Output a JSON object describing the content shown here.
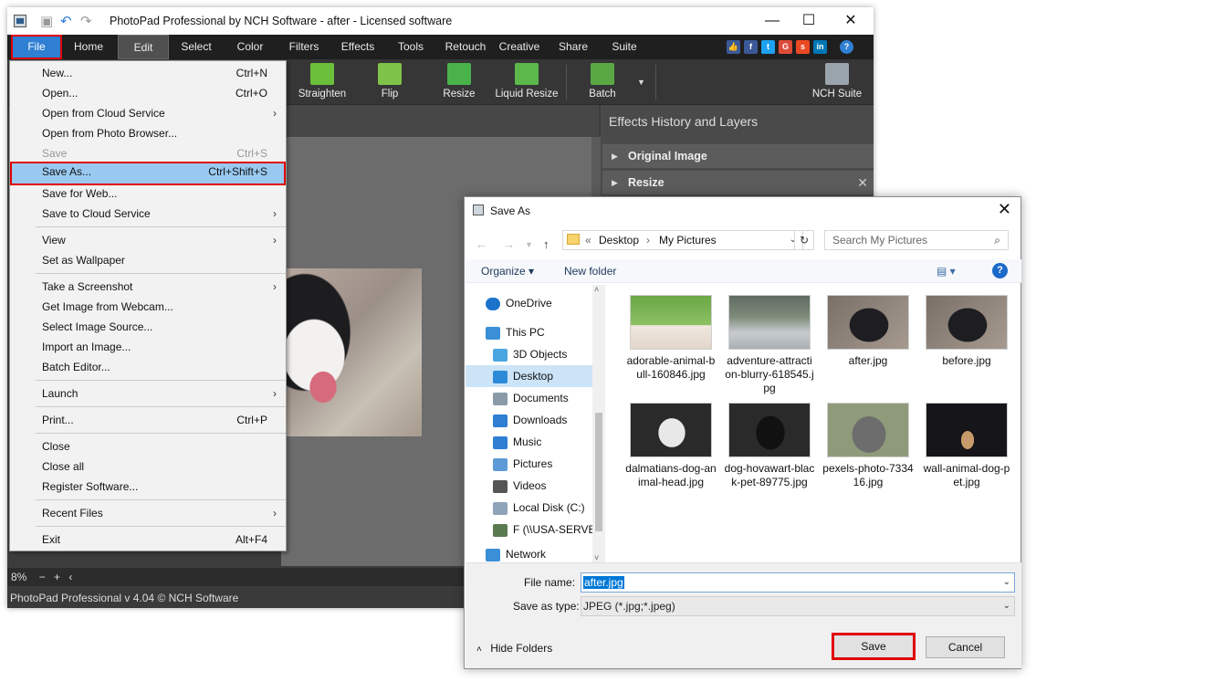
{
  "app": {
    "title": "PhotoPad Professional by NCH Software - after - Licensed software",
    "minimize": "—",
    "maximize": "☐",
    "close": "✕",
    "menu": [
      "File",
      "Home",
      "Edit",
      "Select",
      "Color",
      "Filters",
      "Effects",
      "Tools",
      "Retouch",
      "Creative",
      "Share",
      "Suite"
    ],
    "toolbar": [
      {
        "label": "Straighten",
        "icon": "straighten-icon",
        "color": "#6bbf3a"
      },
      {
        "label": "Flip",
        "icon": "flip-icon",
        "color": "#7fc24a"
      },
      {
        "label": "Resize",
        "icon": "resize-icon",
        "color": "#49b34a"
      },
      {
        "label": "Liquid Resize",
        "icon": "liquid-resize-icon",
        "color": "#5cb84a"
      },
      {
        "label": "Batch",
        "icon": "batch-icon",
        "color": "#5aa844"
      },
      {
        "label": "NCH Suite",
        "icon": "nch-suite-icon",
        "color": "#9aa4ad"
      }
    ],
    "panel_title": "Effects History and Layers",
    "history": [
      "Original Image",
      "Resize"
    ],
    "zoom": "8%",
    "status": "PhotoPad Professional v 4.04 © NCH Software"
  },
  "file_menu": {
    "items": [
      {
        "label": "New...",
        "shortcut": "Ctrl+N"
      },
      {
        "label": "Open...",
        "shortcut": "Ctrl+O"
      },
      {
        "label": "Open from Cloud Service",
        "submenu": true
      },
      {
        "label": "Open from Photo Browser..."
      },
      {
        "label": "Save",
        "shortcut": "Ctrl+S",
        "disabled": true
      },
      {
        "label": "Save As...",
        "shortcut": "Ctrl+Shift+S",
        "highlighted": true
      },
      {
        "label": "Save for Web..."
      },
      {
        "label": "Save to Cloud Service",
        "submenu": true
      },
      {
        "label": "View",
        "submenu": true
      },
      {
        "label": "Set as Wallpaper"
      },
      {
        "label": "Take a Screenshot",
        "submenu": true
      },
      {
        "label": "Get Image from Webcam..."
      },
      {
        "label": "Select Image Source..."
      },
      {
        "label": "Import an Image..."
      },
      {
        "label": "Batch Editor..."
      },
      {
        "label": "Launch",
        "submenu": true
      },
      {
        "label": "Print...",
        "shortcut": "Ctrl+P"
      },
      {
        "label": "Close"
      },
      {
        "label": "Close all"
      },
      {
        "label": "Register Software..."
      },
      {
        "label": "Recent Files",
        "submenu": true
      },
      {
        "label": "Exit",
        "shortcut": "Alt+F4"
      }
    ]
  },
  "dialog": {
    "title": "Save As",
    "close": "✕",
    "breadcrumb": [
      "«",
      "Desktop",
      "›",
      "My Pictures"
    ],
    "search_placeholder": "Search My Pictures",
    "organize": "Organize ▾",
    "new_folder": "New folder",
    "help": "?",
    "nav": [
      {
        "label": "OneDrive",
        "icon": "onedrive-icon",
        "color": "#1c73cc"
      },
      {
        "label": "This PC",
        "icon": "pc-icon",
        "color": "#3a8fd6"
      },
      {
        "label": "3D Objects",
        "icon": "3d-objects-icon",
        "color": "#4aa6e0"
      },
      {
        "label": "Desktop",
        "icon": "desktop-icon",
        "color": "#2d8ad8",
        "selected": true
      },
      {
        "label": "Documents",
        "icon": "documents-icon",
        "color": "#8a9aa8"
      },
      {
        "label": "Downloads",
        "icon": "downloads-icon",
        "color": "#2f7fd3"
      },
      {
        "label": "Music",
        "icon": "music-icon",
        "color": "#2f7fd3"
      },
      {
        "label": "Pictures",
        "icon": "pictures-icon",
        "color": "#5c9bd6"
      },
      {
        "label": "Videos",
        "icon": "videos-icon",
        "color": "#555555"
      },
      {
        "label": "Local Disk (C:)",
        "icon": "disk-icon",
        "color": "#8ea4b8"
      },
      {
        "label": "F (\\\\USA-SERVEF",
        "icon": "network-drive-icon",
        "color": "#5a7a50"
      },
      {
        "label": "Network",
        "icon": "network-icon",
        "color": "#3a8fd6"
      }
    ],
    "files": [
      {
        "name": "adorable-animal-bull-160846.jpg",
        "colors": [
          "#6aa846",
          "#f0e8e0"
        ]
      },
      {
        "name": "adventure-attraction-blurry-618545.jpg",
        "colors": [
          "#7f8c7a",
          "#c8ccd0"
        ]
      },
      {
        "name": "after.jpg",
        "colors": [
          "#7a7068",
          "#1e1e22"
        ]
      },
      {
        "name": "before.jpg",
        "colors": [
          "#7a7068",
          "#1e1e22"
        ]
      },
      {
        "name": "dalmatians-dog-animal-head.jpg",
        "colors": [
          "#2a2a2a",
          "#e8e8e8"
        ]
      },
      {
        "name": "dog-hovawart-black-pet-89775.jpg",
        "colors": [
          "#2a2a2a",
          "#111111"
        ]
      },
      {
        "name": "pexels-photo-733416.jpg",
        "colors": [
          "#8f9a7a",
          "#6d6d6d"
        ]
      },
      {
        "name": "wall-animal-dog-pet.jpg",
        "colors": [
          "#15151a",
          "#c79a6a"
        ]
      }
    ],
    "file_name_label": "File name:",
    "file_name": "after.jpg",
    "save_type_label": "Save as type:",
    "save_type": "JPEG (*.jpg;*.jpeg)",
    "hide_folders": "Hide Folders",
    "save_button": "Save",
    "cancel_button": "Cancel"
  }
}
